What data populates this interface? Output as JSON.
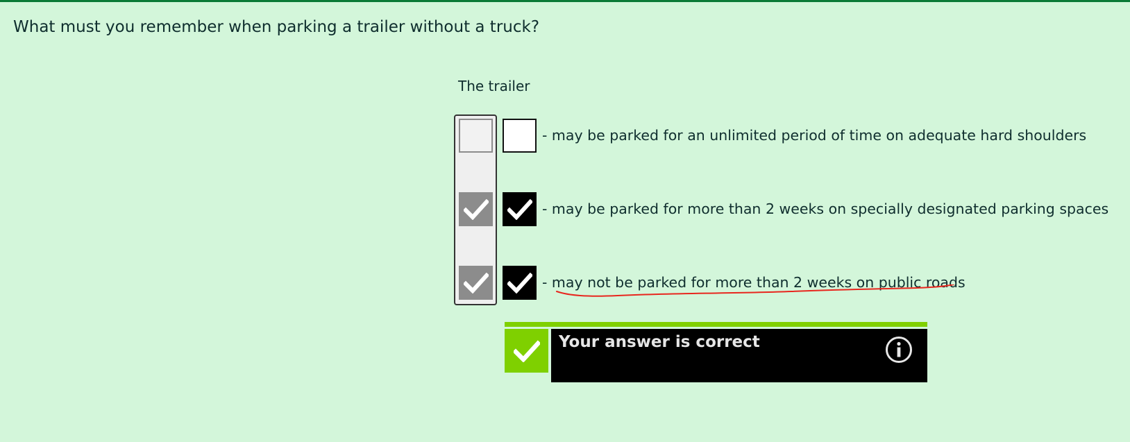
{
  "question": {
    "text": "What must you remember when parking a trailer without a truck?"
  },
  "stem": "The trailer",
  "options": [
    {
      "label": "- may be parked for an unlimited period of time on adequate hard shoulders",
      "selected": false,
      "correct": false
    },
    {
      "label": "- may be parked for more than 2 weeks on specially designated parking spaces",
      "selected": true,
      "correct": true
    },
    {
      "label": "- may not be parked for more than 2 weeks on public roads",
      "selected": true,
      "correct": true
    }
  ],
  "feedback": {
    "text": "Your answer is correct",
    "status_icon": "check-icon",
    "info_icon": "info-icon"
  },
  "colors": {
    "background": "#d3f6da",
    "top_border": "#0a7a36",
    "success_green": "#7fd000",
    "feedback_bg": "#000000",
    "solution_check": "#8c8c8c",
    "annotation_red": "#e8261e"
  }
}
